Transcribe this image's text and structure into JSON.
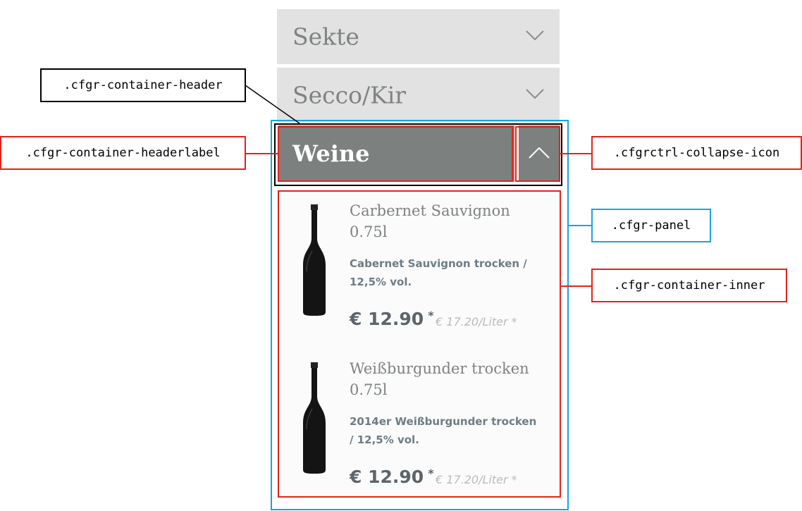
{
  "accordion": {
    "collapsed_items": [
      {
        "label": "Sekte",
        "icon": "chevron-down-icon"
      },
      {
        "label": "Secco/Kir",
        "icon": "chevron-down-icon"
      }
    ],
    "active_panel": {
      "label": "Weine",
      "icon": "chevron-up-icon",
      "products": [
        {
          "name_line1": "Carbernet Sauvignon",
          "name_line2": "0.75l",
          "desc_line1": "Cabernet Sauvignon trocken /",
          "desc_line2": "12,5% vol.",
          "price": "€ 12.90",
          "price_star": "*",
          "unit_price": "€ 17.20/Liter *",
          "image": "wine-bottle-image"
        },
        {
          "name_line1": "Weißburgunder trocken",
          "name_line2": "0.75l",
          "desc_line1": "2014er Weißburgunder trocken",
          "desc_line2": "/ 12,5% vol.",
          "price": "€ 12.90",
          "price_star": "*",
          "unit_price": "€ 17.20/Liter *",
          "image": "wine-bottle-image"
        }
      ]
    }
  },
  "annotations": {
    "container_header": ".cfgr-container-header",
    "container_headerlabel": ".cfgr-container-headerlabel",
    "collapse_icon": ".cfgrctrl-collapse-icon",
    "panel": ".cfgr-panel",
    "container_inner": ".cfgr-container-inner"
  },
  "colors": {
    "annotation_red": "#e2231a",
    "annotation_blue": "#1aa3e0",
    "annotation_black": "#000000",
    "header_active_bg": "#7c807e",
    "header_collapsed_bg": "#e1e2e1"
  }
}
